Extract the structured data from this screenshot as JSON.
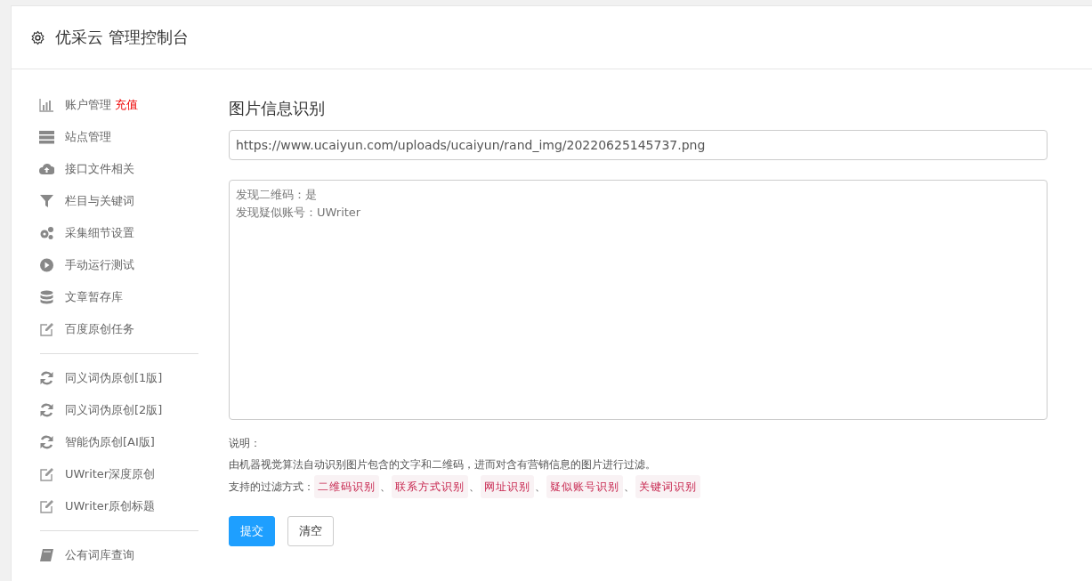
{
  "header": {
    "title": "优采云 管理控制台"
  },
  "sidebar": {
    "groups": [
      {
        "items": [
          {
            "kind": "chart",
            "label": "账户管理",
            "extra": "充值"
          },
          {
            "kind": "server",
            "label": "站点管理"
          },
          {
            "kind": "cloud",
            "label": "接口文件相关"
          },
          {
            "kind": "filter",
            "label": "栏目与关键词"
          },
          {
            "kind": "gears",
            "label": "采集细节设置"
          },
          {
            "kind": "play",
            "label": "手动运行测试"
          },
          {
            "kind": "database",
            "label": "文章暂存库"
          },
          {
            "kind": "edit",
            "label": "百度原创任务"
          }
        ]
      },
      {
        "items": [
          {
            "kind": "refresh",
            "label": "同义词伪原创[1版]"
          },
          {
            "kind": "refresh",
            "label": "同义词伪原创[2版]"
          },
          {
            "kind": "refresh",
            "label": "智能伪原创[AI版]"
          },
          {
            "kind": "edit",
            "label": "UWriter深度原创"
          },
          {
            "kind": "edit",
            "label": "UWriter原创标题"
          }
        ]
      },
      {
        "items": [
          {
            "kind": "book",
            "label": "公有词库查询"
          }
        ]
      }
    ]
  },
  "main": {
    "title": "图片信息识别",
    "url_field": {
      "value": "https://www.ucaiyun.com/uploads/ucaiyun/rand_img/20220625145737.png"
    },
    "result_box": {
      "lines": [
        "发现二维码：是",
        "发现疑似账号：UWriter"
      ]
    },
    "notes": {
      "heading": "说明：",
      "description": "由机器视觉算法自动识别图片包含的文字和二维码，进而对含有营销信息的图片进行过滤。",
      "methods_label": "支持的过滤方式：",
      "separator": "、",
      "methods": [
        "二维码识别",
        "联系方式识别",
        "网址识别",
        "疑似账号识别",
        "关键词识别"
      ]
    },
    "buttons": [
      {
        "label": "提交",
        "kind": "primary"
      },
      {
        "label": "清空",
        "kind": "default"
      }
    ]
  }
}
